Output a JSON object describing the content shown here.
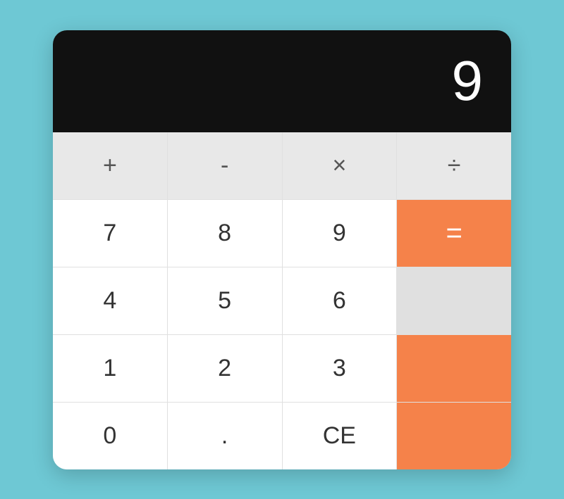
{
  "display": {
    "value": "9"
  },
  "buttons": {
    "operators": [
      {
        "id": "plus",
        "label": "+",
        "type": "operator"
      },
      {
        "id": "minus",
        "label": "-",
        "type": "operator"
      },
      {
        "id": "multiply",
        "label": "×",
        "type": "operator"
      },
      {
        "id": "divide",
        "label": "÷",
        "type": "operator"
      }
    ],
    "row1": [
      {
        "id": "seven",
        "label": "7"
      },
      {
        "id": "eight",
        "label": "8"
      },
      {
        "id": "nine",
        "label": "9"
      }
    ],
    "row2": [
      {
        "id": "four",
        "label": "4"
      },
      {
        "id": "five",
        "label": "5"
      },
      {
        "id": "six",
        "label": "6"
      }
    ],
    "row3": [
      {
        "id": "one",
        "label": "1"
      },
      {
        "id": "two",
        "label": "2"
      },
      {
        "id": "three",
        "label": "3"
      }
    ],
    "row4": [
      {
        "id": "zero",
        "label": "0"
      },
      {
        "id": "dot",
        "label": "."
      },
      {
        "id": "ce",
        "label": "CE"
      }
    ],
    "equals": {
      "id": "equals",
      "label": "="
    }
  }
}
